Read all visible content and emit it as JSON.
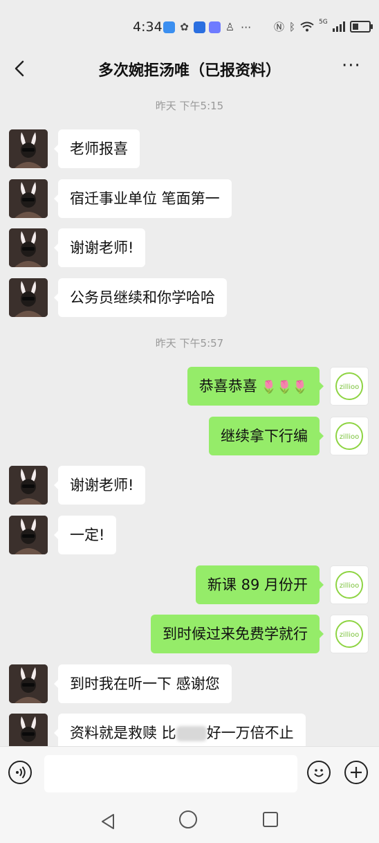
{
  "status_bar": {
    "time": "4:34",
    "dots": "···",
    "network_label": "5G"
  },
  "header": {
    "title": "多次婉拒汤唯（已报资料）",
    "more": "···"
  },
  "colors": {
    "background": "#ededed",
    "incoming_bubble": "#ffffff",
    "outgoing_bubble": "#95ec69",
    "timestamp": "#999999"
  },
  "messages": [
    {
      "type": "timestamp",
      "text": "昨天 下午5:15"
    },
    {
      "type": "incoming",
      "text": "老师报喜"
    },
    {
      "type": "incoming",
      "text": "宿迁事业单位 笔面第一"
    },
    {
      "type": "incoming",
      "text": "谢谢老师!"
    },
    {
      "type": "incoming",
      "text": "公务员继续和你学哈哈"
    },
    {
      "type": "timestamp",
      "text": "昨天 下午5:57"
    },
    {
      "type": "outgoing",
      "text": "恭喜恭喜",
      "emoji": "🌷🌷🌷"
    },
    {
      "type": "outgoing",
      "text": "继续拿下行编"
    },
    {
      "type": "incoming",
      "text": "谢谢老师!"
    },
    {
      "type": "incoming",
      "text": "一定!"
    },
    {
      "type": "outgoing",
      "text": "新课 89 月份开"
    },
    {
      "type": "outgoing",
      "text": "到时候过来免费学就行"
    },
    {
      "type": "incoming",
      "text": "到时我在听一下  感谢您"
    },
    {
      "type": "incoming",
      "text_before": "资料就是救赎 比",
      "text_after": "好一万倍不止"
    }
  ],
  "outgoing_avatar_text": "zillioo",
  "icons": [
    "back-icon",
    "more-icon",
    "voice-icon",
    "emoji-icon",
    "plus-icon",
    "nav-back-icon",
    "nav-home-icon",
    "nav-recent-icon"
  ]
}
